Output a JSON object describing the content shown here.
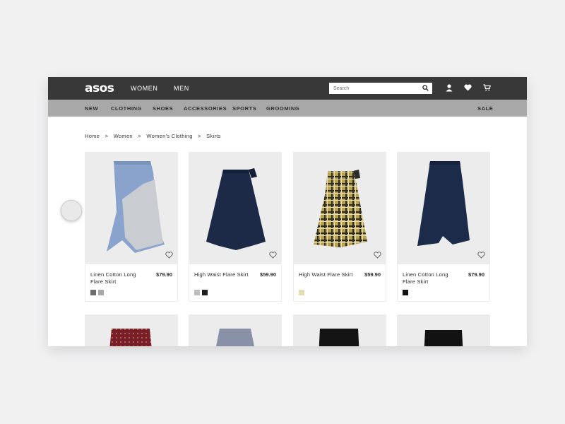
{
  "header": {
    "logo": "asos",
    "genders": [
      "WOMEN",
      "MEN"
    ],
    "search_placeholder": "Search",
    "icons": [
      "search-icon",
      "account-icon",
      "heart-icon",
      "bag-icon"
    ],
    "bg_color": "#383838"
  },
  "categories": {
    "items": [
      "NEW",
      "CLOTHING",
      "SHOES",
      "ACCESSORIES",
      "SPORTS",
      "GROOMING"
    ],
    "sale": "SALE",
    "bg_color": "#a8a8a8"
  },
  "breadcrumb": [
    "Home",
    ">",
    "Women",
    ">",
    "Women's Clothing",
    ">",
    "Skirts"
  ],
  "products": [
    {
      "name": "Linen Cotton Long Flare Skirt",
      "price": "$79.90",
      "swatches": [
        "#6f6f6f",
        "#a8a8a8"
      ]
    },
    {
      "name": "High Waist Flare Skirt",
      "price": "$59.90",
      "swatches": [
        "#bdbdbd",
        "#1f1f1f"
      ]
    },
    {
      "name": "High Waist Flare Skirt",
      "price": "$59.90",
      "swatches": [
        "#e8dcb4"
      ]
    },
    {
      "name": "Linen Cotton Long Flare Skirt",
      "price": "$79.90",
      "swatches": [
        "#111111"
      ]
    }
  ]
}
